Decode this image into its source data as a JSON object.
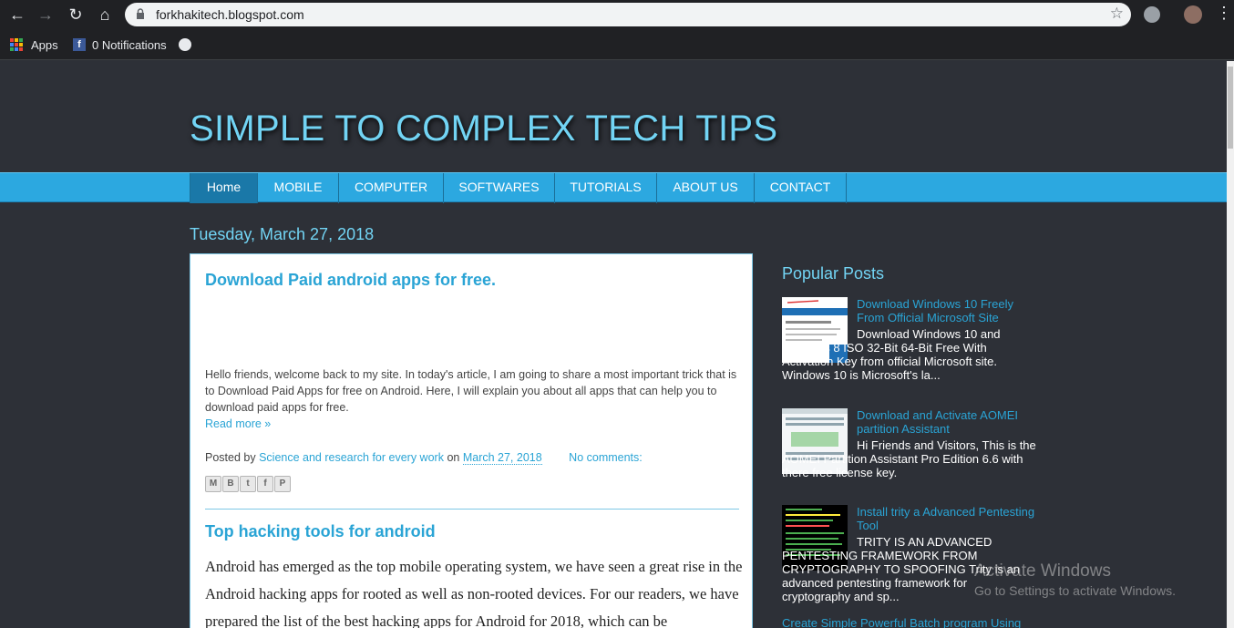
{
  "browser": {
    "url": "forkhakitech.blogspot.com",
    "bookmarks": [
      {
        "label": "Apps",
        "icon": "apps-grid-icon"
      },
      {
        "label": "0 Notifications",
        "icon": "facebook-icon"
      },
      {
        "label": "",
        "icon": "globe-icon"
      }
    ]
  },
  "blog": {
    "title": "SIMPLE TO COMPLEX TECH TIPS",
    "nav": [
      "Home",
      "MOBILE",
      "COMPUTER",
      "SOFTWARES",
      "TUTORIALS",
      "ABOUT US",
      "CONTACT"
    ],
    "active_tab": "Home"
  },
  "date_header": "Tuesday, March 27, 2018",
  "posts": [
    {
      "title": "Download Paid android apps for free.",
      "body": "Hello friends, welcome back to my site. In today's article, I am going to share a most important trick that is to Download Paid Apps for free on Android. Here, I will explain you about all apps that can help you to download paid apps for free.",
      "read_more": "Read more »",
      "posted_by_prefix": "Posted by",
      "author": "Science and research for every work",
      "on": "on",
      "date": "March 27, 2018",
      "comments": "No comments:"
    },
    {
      "title": "Top hacking tools for android",
      "body": "Android has emerged as the top mobile operating system, we have seen a great rise in the Android hacking apps for rooted as well as non-rooted devices. For our readers, we have prepared the list of the best hacking apps for Android for 2018, which can be"
    }
  ],
  "share_buttons": [
    "email-icon",
    "blogger-icon",
    "twitter-icon",
    "facebook-icon",
    "pinterest-icon"
  ],
  "sidebar": {
    "title": "Popular Posts",
    "items": [
      {
        "title": "Download Windows 10 Freely From Official Microsoft Site",
        "snippet": "Download Windows 10 and Windows 8 ISO 32-Bit 64-Bit Free With Activation Key from official Microsoft site. Windows 10 is Microsoft's la..."
      },
      {
        "title": "Download and Activate AOMEI partition Assistant",
        "snippet": "Hi Friends and Visitors, This is the AOMEI Partition Assistant Pro Edition 6.6 with there free license key."
      },
      {
        "title": "Install trity a Advanced Pentesting Tool",
        "snippet": "TRITY IS AN ADVANCED PENTESTING FRAMEWORK FROM CRYPTOGRAPHY TO SPOOFING Trity is an advanced pentesting framework for cryptography and sp..."
      },
      {
        "title": "Create Simple Powerful Batch program Using",
        "snippet": ""
      }
    ]
  },
  "watermark": {
    "line1": "Activate Windows",
    "line2": "Go to Settings to activate Windows."
  },
  "colors": {
    "background": "#2d3037",
    "accent": "#72d4f4",
    "nav_bar": "#2ca8e0",
    "link": "#2aa4d5"
  }
}
